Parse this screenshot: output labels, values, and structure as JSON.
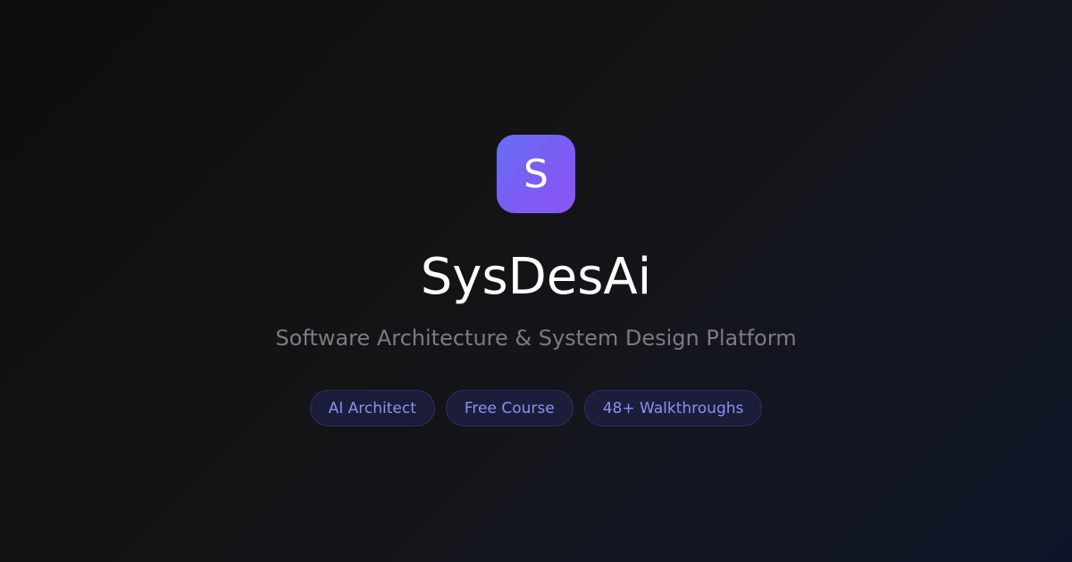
{
  "logo": {
    "letter": "S",
    "colors": [
      "#6470f3",
      "#8b55f5"
    ]
  },
  "title": "SysDesAi",
  "subtitle": "Software Architecture & System Design Platform",
  "badges": [
    {
      "label": "AI Architect"
    },
    {
      "label": "Free Course"
    },
    {
      "label": "48+ Walkthroughs"
    }
  ],
  "colors": {
    "accent": "#8d90f0",
    "badge_bg": "#1c1d3a",
    "subtitle": "#7b7b82"
  }
}
